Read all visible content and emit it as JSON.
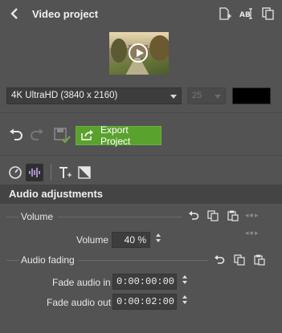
{
  "header": {
    "title": "Video project",
    "back_icon": "chevron-left-icon",
    "icons": [
      "new-file-icon",
      "rename-icon",
      "duplicate-icon"
    ]
  },
  "preview": {
    "play_icon": "play-circle-icon"
  },
  "format": {
    "resolution": "4K UltraHD (3840 x 2160)",
    "fps": "25",
    "background_color": "#000000"
  },
  "actions": {
    "export_label": "Export Project",
    "export_color": "#5aa22e"
  },
  "audio": {
    "header": "Audio adjustments",
    "volume_group": "Volume",
    "volume_label": "Volume",
    "volume_value": "40 %",
    "fading_group": "Audio fading",
    "fade_in_label": "Fade audio in",
    "fade_in_value": "0:00:00:00",
    "fade_out_label": "Fade audio out",
    "fade_out_value": "0:00:02:00"
  }
}
